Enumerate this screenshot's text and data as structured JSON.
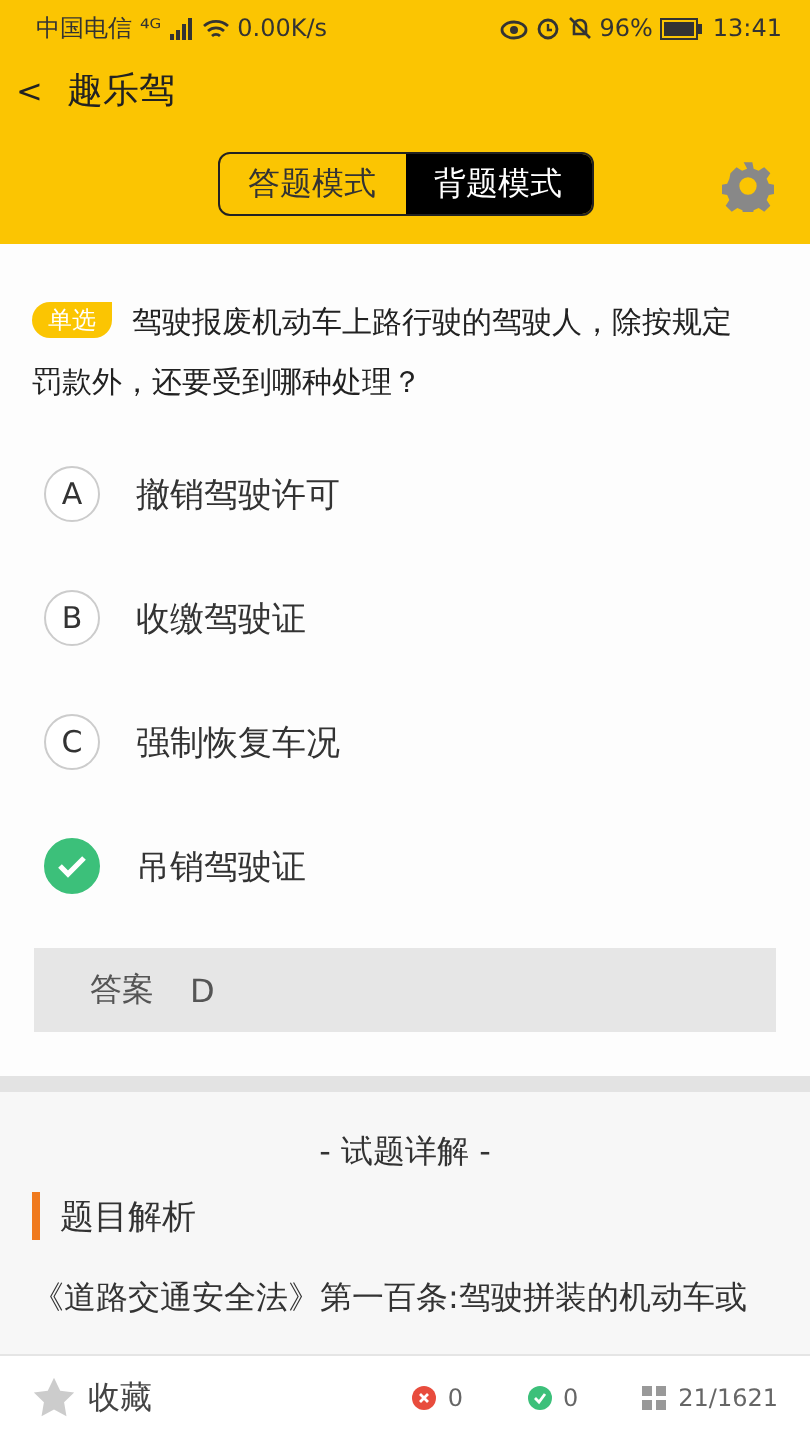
{
  "status_bar": {
    "carrier": "中国电信",
    "network": "⁴ᴳ",
    "speed": "0.00K/s",
    "battery": "96%",
    "time": "13:41"
  },
  "header": {
    "back": "<",
    "title": "趣乐驾"
  },
  "mode_tabs": [
    {
      "label": "答题模式",
      "selected": false
    },
    {
      "label": "背题模式",
      "selected": true
    }
  ],
  "question": {
    "type_badge": "单选",
    "text": "驾驶报废机动车上路行驶的驾驶人，除按规定罚款外，还要受到哪种处理？"
  },
  "options": [
    {
      "letter": "A",
      "text": "撤销驾驶许可",
      "correct": false
    },
    {
      "letter": "B",
      "text": "收缴驾驶证",
      "correct": false
    },
    {
      "letter": "C",
      "text": "强制恢复车况",
      "correct": false
    },
    {
      "text": "吊销驾驶证",
      "correct": true
    }
  ],
  "answer": {
    "label": "答案",
    "value": "D"
  },
  "details": {
    "heading": "- 试题详解 -",
    "section_title": "题目解析",
    "text": "《道路交通安全法》第一百条:驾驶拼装的机动车或"
  },
  "bottom_bar": {
    "favorite": "收藏",
    "wrong_count": "0",
    "right_count": "0",
    "progress": "21/1621"
  }
}
